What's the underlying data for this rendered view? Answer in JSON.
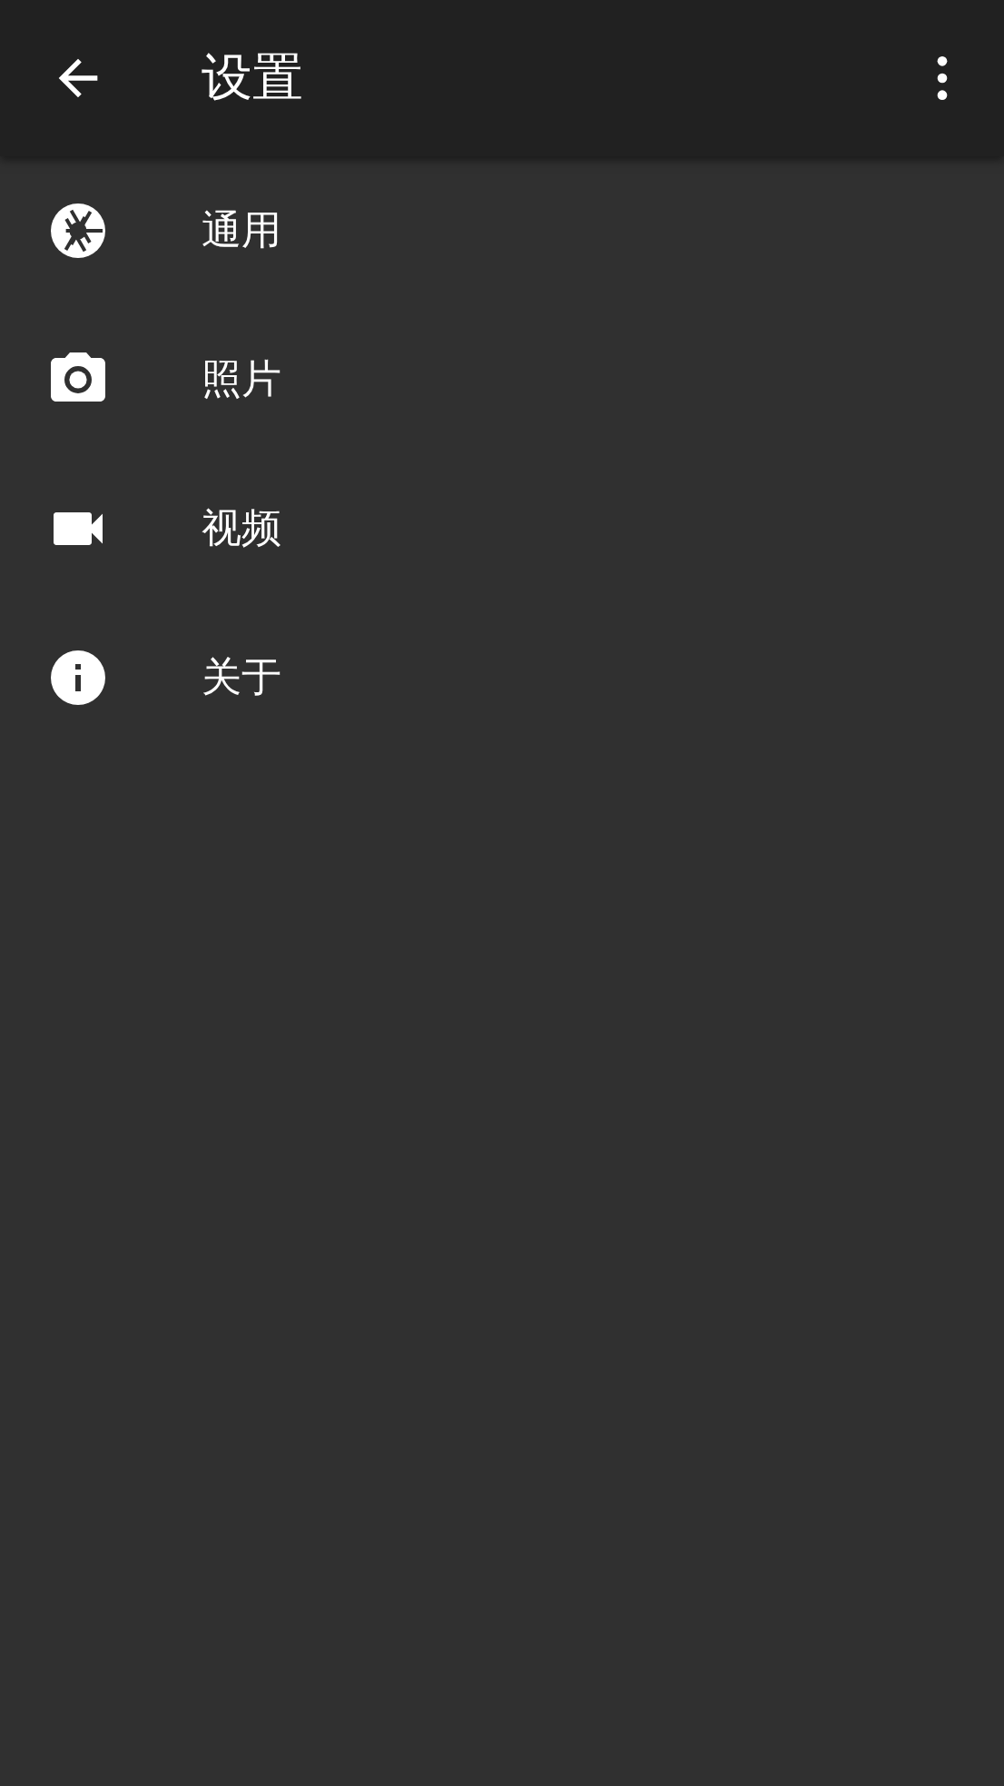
{
  "app_bar": {
    "title": "设置"
  },
  "items": [
    {
      "label": "通用"
    },
    {
      "label": "照片"
    },
    {
      "label": "视频"
    },
    {
      "label": "关于"
    }
  ]
}
